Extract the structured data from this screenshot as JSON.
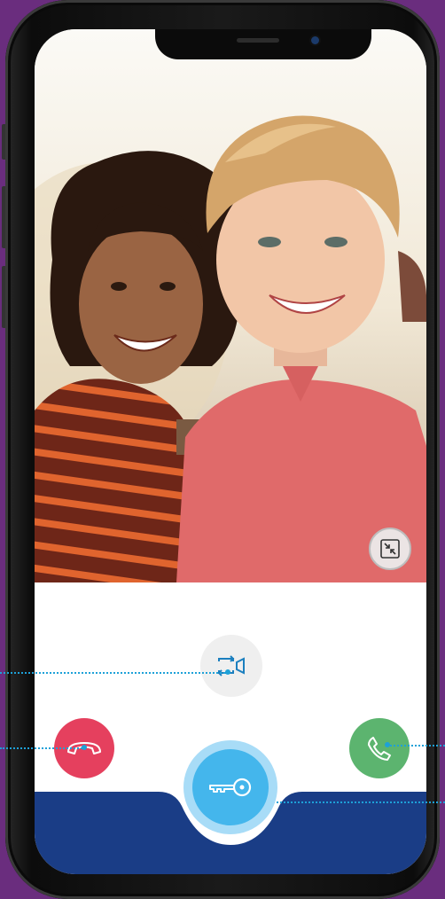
{
  "app": {
    "title": ""
  },
  "colors": {
    "background_purple": "#6a2d7e",
    "hangup_red": "#e5405e",
    "answer_green": "#5cb46f",
    "key_blue": "#44b6ec",
    "bottom_bar_navy": "#1a3d86",
    "guide_line_blue": "#1ea1d8"
  },
  "video_feed": {
    "icon": "video-feed-photo"
  },
  "controls": {
    "minimize": {
      "icon": "minimize-arrows-icon"
    },
    "switch_camera": {
      "icon": "switch-camera-icon"
    },
    "hang_up": {
      "icon": "hang-up-icon"
    },
    "answer": {
      "icon": "phone-icon"
    },
    "unlock": {
      "icon": "key-icon"
    }
  }
}
